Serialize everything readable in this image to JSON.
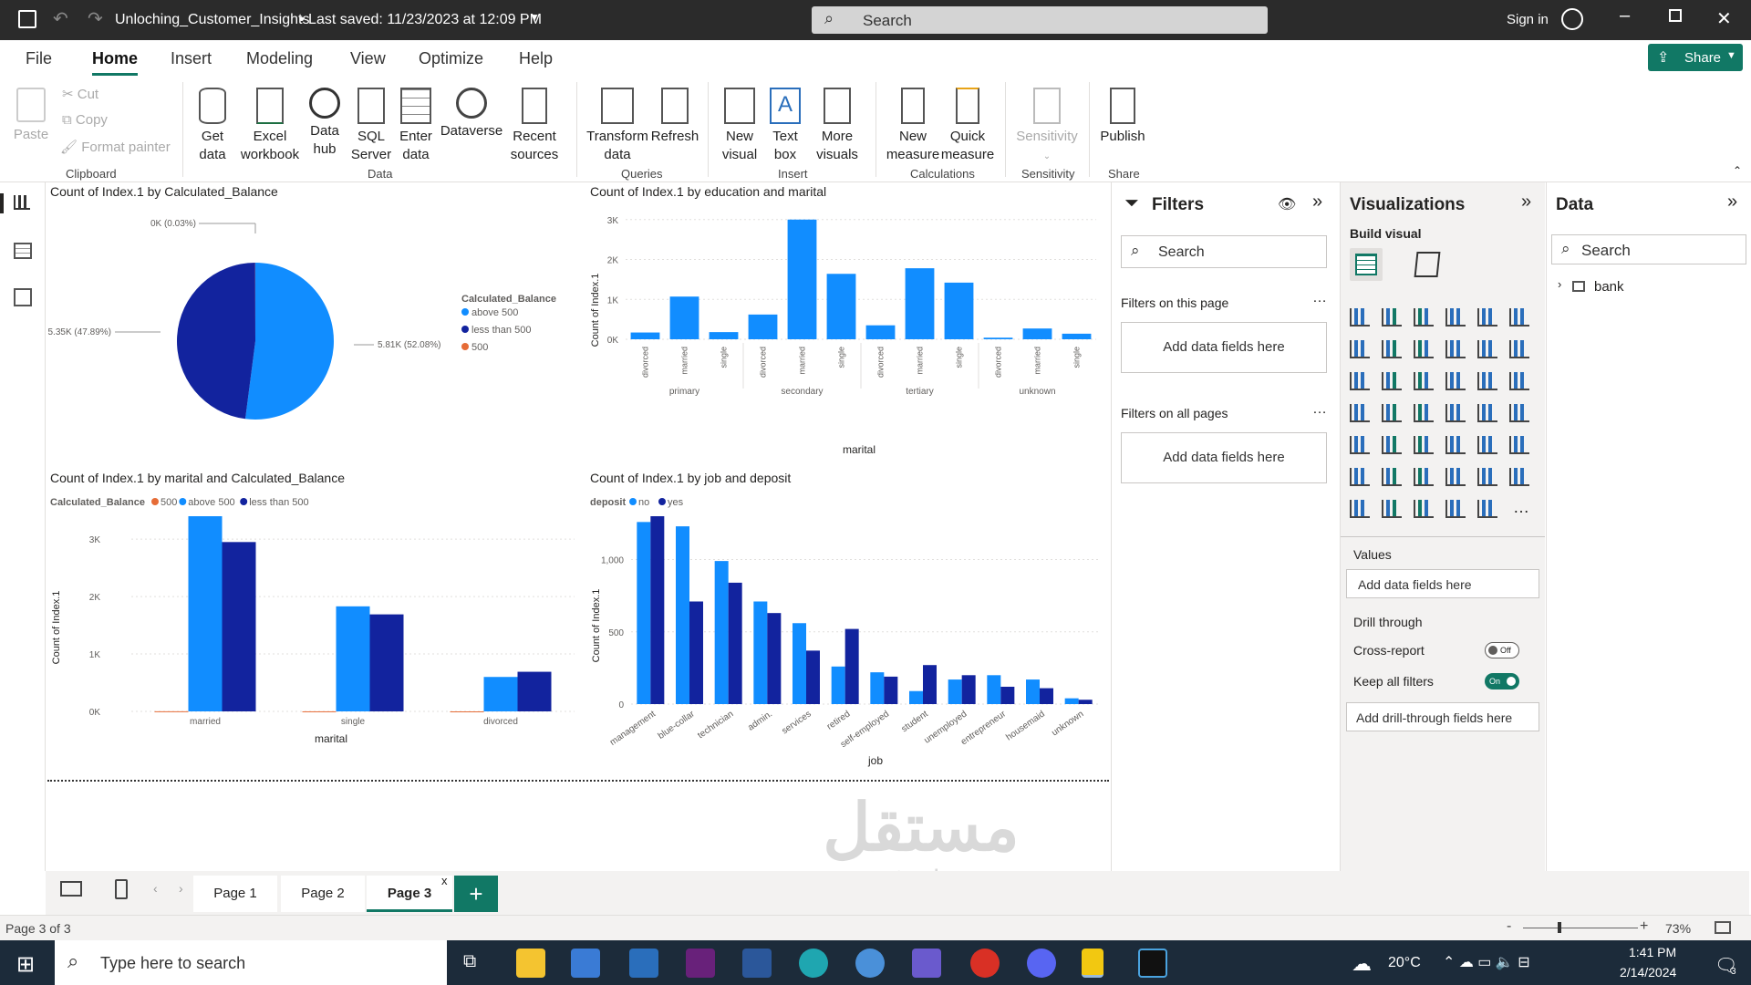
{
  "titlebar": {
    "filename": "Unloching_Customer_Insights",
    "saved": "•  Last saved: 11/23/2023 at 12:09 PM",
    "search": "Search",
    "signin": "Sign in"
  },
  "menu": {
    "tabs": [
      "File",
      "Home",
      "Insert",
      "Modeling",
      "View",
      "Optimize",
      "Help"
    ],
    "share": "Share"
  },
  "ribbon": {
    "clipboard": {
      "paste": "Paste",
      "cut": "Cut",
      "copy": "Copy",
      "format_painter": "Format painter",
      "group": "Clipboard"
    },
    "data": {
      "get_data": [
        "Get",
        "data"
      ],
      "excel": [
        "Excel",
        "workbook"
      ],
      "hub": [
        "Data",
        "hub"
      ],
      "sql": [
        "SQL",
        "Server"
      ],
      "enter": [
        "Enter",
        "data"
      ],
      "dataverse": "Dataverse",
      "recent": [
        "Recent",
        "sources"
      ],
      "group": "Data"
    },
    "queries": {
      "transform": [
        "Transform",
        "data"
      ],
      "refresh": "Refresh",
      "group": "Queries"
    },
    "insert": {
      "new_visual": [
        "New",
        "visual"
      ],
      "text_box": [
        "Text",
        "box"
      ],
      "more_visuals": [
        "More",
        "visuals"
      ],
      "group": "Insert"
    },
    "calculations": {
      "new_measure": [
        "New",
        "measure"
      ],
      "quick_measure": [
        "Quick",
        "measure"
      ],
      "group": "Calculations"
    },
    "sensitivity": {
      "label": "Sensitivity",
      "group": "Sensitivity"
    },
    "share": {
      "publish": "Publish",
      "group": "Share"
    }
  },
  "charts": {
    "pie": {
      "title": "Count of Index.1 by Calculated_Balance",
      "legend_title": "Calculated_Balance",
      "labels": [
        "0K (0.03%)",
        "5.81K (52.08%)",
        "5.35K (47.89%)"
      ]
    },
    "edu": {
      "title": "Count of Index.1 by education and marital",
      "ylabel": "Count of Index.1",
      "xlabel": "marital",
      "yticks": [
        "3K",
        "2K",
        "1K",
        "0K"
      ],
      "sub": [
        "divorced",
        "married",
        "single"
      ]
    },
    "mar": {
      "title": "Count of Index.1 by marital and Calculated_Balance",
      "legend_title": "Calculated_Balance",
      "ylabel": "Count of Index.1",
      "xlabel": "marital",
      "yticks": [
        "3K",
        "2K",
        "1K",
        "0K"
      ]
    },
    "job": {
      "title": "Count of Index.1 by job and deposit",
      "legend_title": "deposit",
      "ylabel": "Count of Index.1",
      "xlabel": "job",
      "yticks": [
        "1,000",
        "500",
        "0"
      ]
    }
  },
  "chart_data": [
    {
      "type": "pie",
      "title": "Count of Index.1 by Calculated_Balance",
      "legend": "Calculated_Balance",
      "slices": [
        {
          "name": "above 500",
          "value": 5810,
          "pct": 52.08,
          "color": "#118dff"
        },
        {
          "name": "less than 500",
          "value": 5350,
          "pct": 47.89,
          "color": "#12239e"
        },
        {
          "name": "500",
          "value": 3,
          "pct": 0.03,
          "color": "#e66c37"
        }
      ]
    },
    {
      "type": "bar",
      "title": "Count of Index.1 by education and marital",
      "xlabel": "marital",
      "ylabel": "Count of Index.1",
      "ylim": [
        0,
        3200
      ],
      "groups": [
        "primary",
        "secondary",
        "tertiary",
        "unknown"
      ],
      "categories": [
        "divorced",
        "married",
        "single",
        "divorced",
        "married",
        "single",
        "divorced",
        "married",
        "single",
        "divorced",
        "married",
        "single"
      ],
      "values": [
        170,
        1070,
        180,
        620,
        3000,
        1640,
        350,
        1780,
        1420,
        40,
        270,
        140
      ]
    },
    {
      "type": "bar",
      "title": "Count of Index.1 by marital and Calculated_Balance",
      "xlabel": "marital",
      "ylabel": "Count of Index.1",
      "ylim": [
        0,
        3400
      ],
      "categories": [
        "married",
        "single",
        "divorced"
      ],
      "series": [
        {
          "name": "500",
          "color": "#e66c37",
          "values": [
            2,
            1,
            0
          ]
        },
        {
          "name": "above 500",
          "color": "#118dff",
          "values": [
            3400,
            1830,
            600
          ]
        },
        {
          "name": "less than 500",
          "color": "#12239e",
          "values": [
            2950,
            1690,
            690
          ]
        }
      ]
    },
    {
      "type": "bar",
      "title": "Count of Index.1 by job and deposit",
      "xlabel": "job",
      "ylabel": "Count of Index.1",
      "ylim": [
        0,
        1300
      ],
      "categories": [
        "management",
        "blue-collar",
        "technician",
        "admin.",
        "services",
        "retired",
        "self-employed",
        "student",
        "unemployed",
        "entrepreneur",
        "housemaid",
        "unknown"
      ],
      "series": [
        {
          "name": "no",
          "color": "#118dff",
          "values": [
            1260,
            1230,
            990,
            710,
            560,
            260,
            220,
            90,
            170,
            200,
            170,
            40
          ]
        },
        {
          "name": "yes",
          "color": "#12239e",
          "values": [
            1300,
            710,
            840,
            630,
            370,
            520,
            190,
            270,
            200,
            120,
            110,
            30
          ]
        }
      ]
    }
  ],
  "filters": {
    "title": "Filters",
    "search": "Search",
    "on_page": "Filters on this page",
    "on_all": "Filters on all pages",
    "add": "Add data fields here"
  },
  "viz": {
    "title": "Visualizations",
    "build": "Build visual",
    "values": "Values",
    "add_values": "Add data fields here",
    "drill": "Drill through",
    "cross": "Cross-report",
    "cross_state": "Off",
    "keep": "Keep all filters",
    "keep_state": "On",
    "add_drill": "Add drill-through fields here"
  },
  "data_panel": {
    "title": "Data",
    "search": "Search",
    "table": "bank"
  },
  "pages": {
    "tabs": [
      "Page 1",
      "Page 2",
      "Page 3"
    ],
    "status": "Page 3 of 3",
    "zoom": "73%"
  },
  "taskbar": {
    "search": "Type here to search",
    "temp": "20°C",
    "time": "1:41 PM",
    "date": "2/14/2024",
    "notif": "3"
  },
  "watermark": {
    "text": "مستقل",
    "sub": "mostaql.com"
  },
  "colors": {
    "accent": "#118dff",
    "dark": "#12239e",
    "orange": "#e66c37",
    "green": "#117865"
  }
}
